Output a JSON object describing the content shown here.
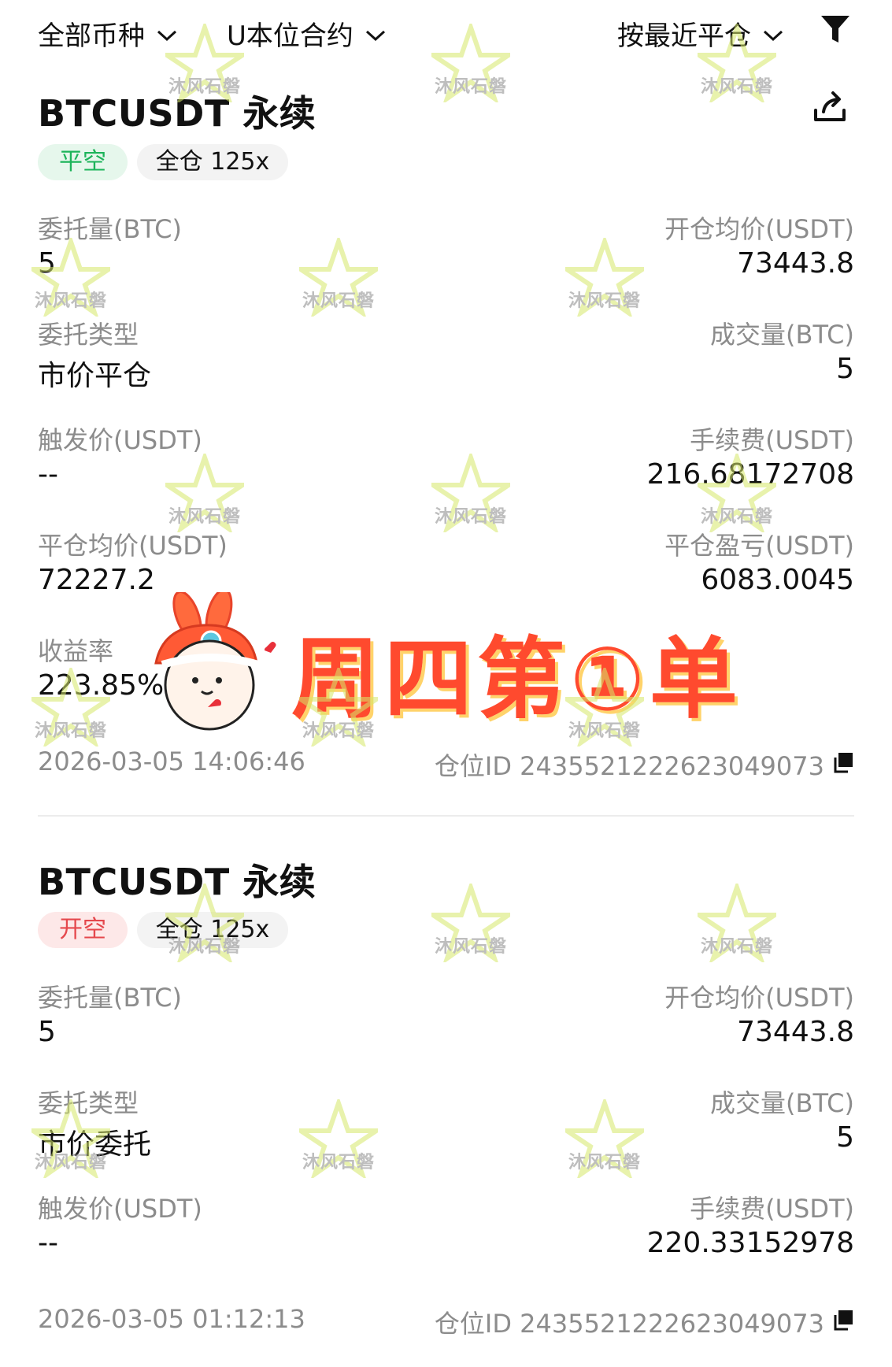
{
  "filters": {
    "currency": "全部币种",
    "contract_type": "U本位合约",
    "sort": "按最近平仓"
  },
  "watermark": "沐风石磐",
  "orders": [
    {
      "symbol": "BTCUSDT 永续",
      "side_tag": "平空",
      "side_color": "#1db45a",
      "margin_tag": "全仓 125x",
      "fields": {
        "order_qty": {
          "label": "委托量(BTC)",
          "value": "5"
        },
        "open_avg": {
          "label": "开仓均价(USDT)",
          "value": "73443.8"
        },
        "order_type": {
          "label": "委托类型",
          "value": "市价平仓"
        },
        "filled_qty": {
          "label": "成交量(BTC)",
          "value": "5"
        },
        "trigger_price": {
          "label": "触发价(USDT)",
          "value": "--"
        },
        "fee": {
          "label": "手续费(USDT)",
          "value": "216.68172708"
        },
        "close_avg": {
          "label": "平仓均价(USDT)",
          "value": "72227.2"
        },
        "pnl": {
          "label": "平仓盈亏(USDT)",
          "value": "6083.0045"
        },
        "roi": {
          "label": "收益率",
          "value": "223.85%"
        }
      },
      "time": "2026-03-05 14:06:46",
      "position_id": "仓位ID 2435521222623049073"
    },
    {
      "symbol": "BTCUSDT 永续",
      "side_tag": "开空",
      "side_color": "#e5484d",
      "margin_tag": "全仓 125x",
      "fields": {
        "order_qty": {
          "label": "委托量(BTC)",
          "value": "5"
        },
        "open_avg": {
          "label": "开仓均价(USDT)",
          "value": "73443.8"
        },
        "order_type": {
          "label": "委托类型",
          "value": "市价委托"
        },
        "filled_qty": {
          "label": "成交量(BTC)",
          "value": "5"
        },
        "trigger_price": {
          "label": "触发价(USDT)",
          "value": "--"
        },
        "fee": {
          "label": "手续费(USDT)",
          "value": "220.33152978"
        }
      },
      "time": "2026-03-05 01:12:13",
      "position_id": "仓位ID 2435521222623049073"
    }
  ],
  "sticker": {
    "text": "周四第①单"
  }
}
